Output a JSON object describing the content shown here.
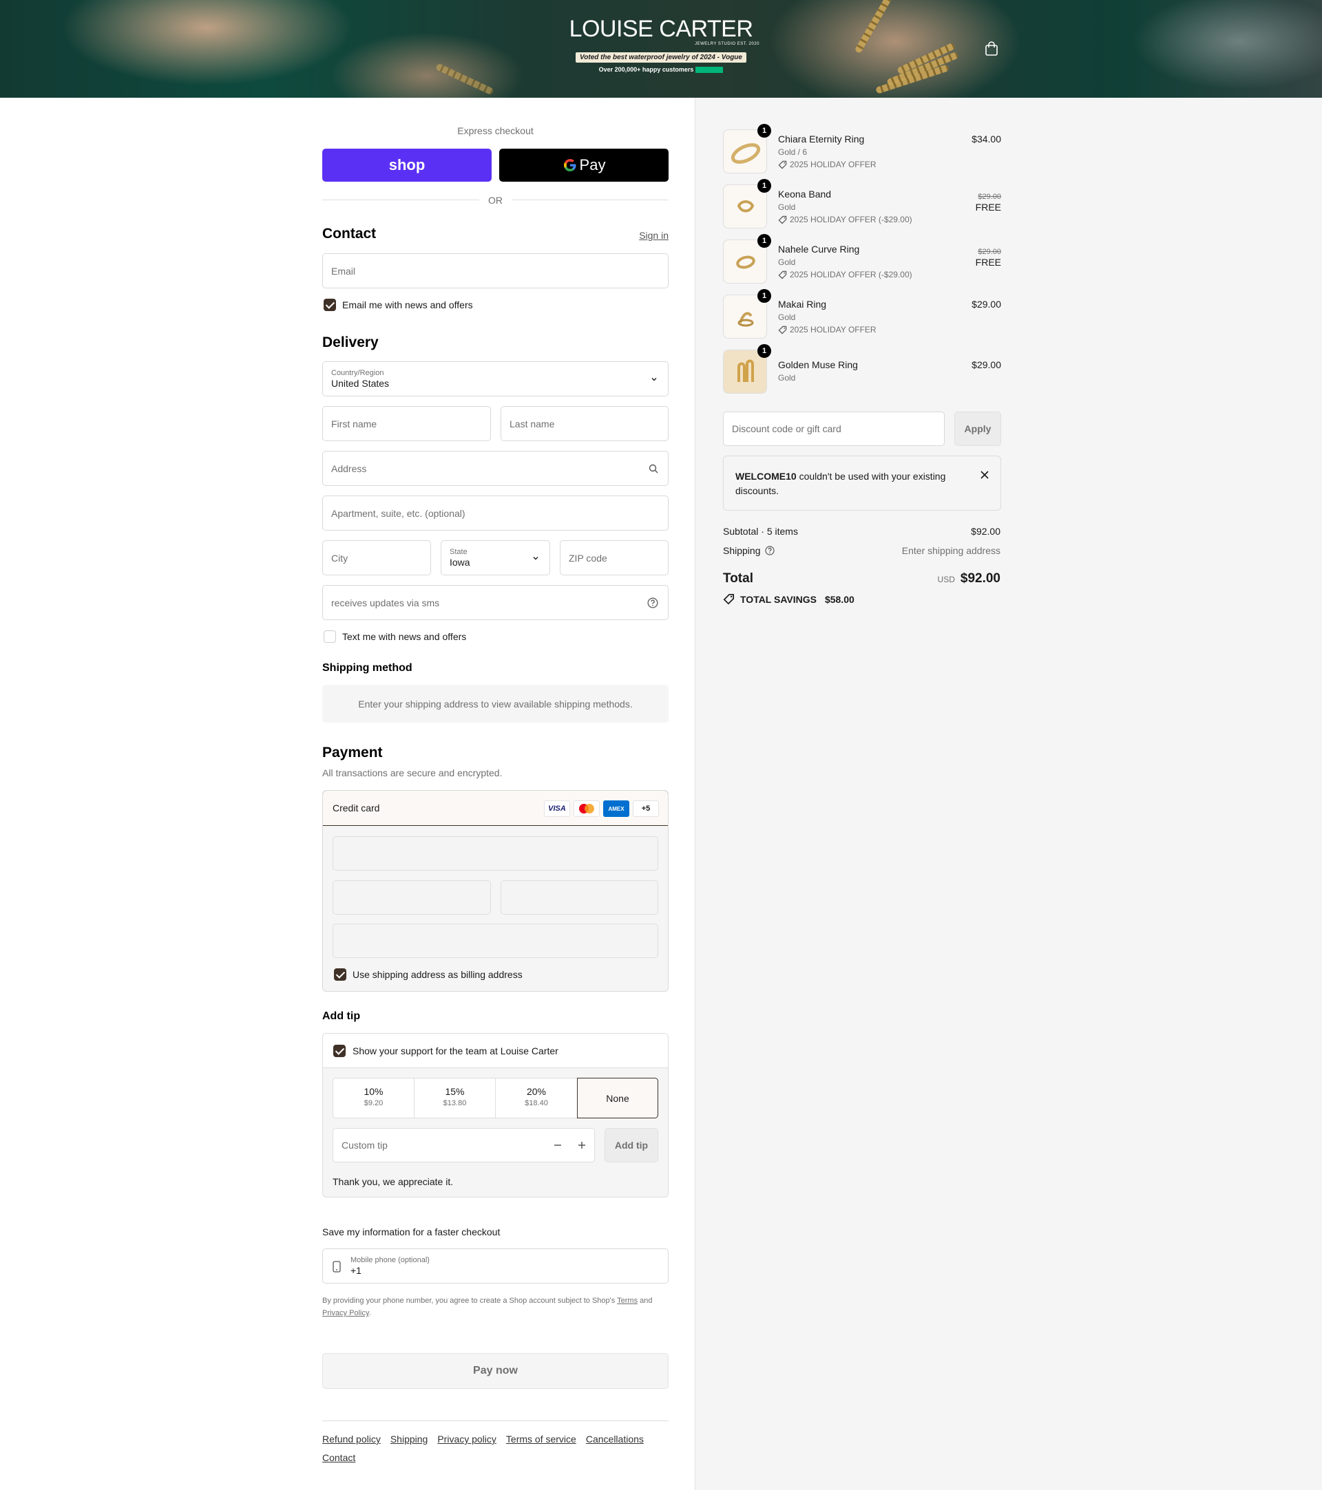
{
  "header": {
    "brand_name": "LOUISE CARTER",
    "brand_sub": "JEWELRY STUDIO EST. 2020",
    "badge": "Voted the best waterproof jewelry of 2024 - Vogue",
    "happy": "Over 200,000+ happy customers"
  },
  "express": {
    "title": "Express checkout",
    "shop_label": "shop",
    "gpay_label": "Pay",
    "or_label": "OR"
  },
  "contact": {
    "title": "Contact",
    "sign_in": "Sign in",
    "email_placeholder": "Email",
    "news_label": "Email me with news and offers"
  },
  "delivery": {
    "title": "Delivery",
    "country_label": "Country/Region",
    "country_value": "United States",
    "first_name": "First name",
    "last_name": "Last name",
    "address": "Address",
    "apartment": "Apartment, suite, etc. (optional)",
    "city": "City",
    "state_label": "State",
    "state_value": "Iowa",
    "zip": "ZIP code",
    "phone": "receives updates via sms",
    "sms_label": "Text me with news and offers"
  },
  "shipping_method": {
    "title": "Shipping method",
    "message": "Enter your shipping address to view available shipping methods."
  },
  "payment": {
    "title": "Payment",
    "subtitle": "All transactions are secure and encrypted.",
    "method": "Credit card",
    "cards": [
      "VISA",
      "MC",
      "AMEX",
      "+5"
    ],
    "billing_label": "Use shipping address as billing address"
  },
  "tip": {
    "title": "Add tip",
    "support_label": "Show your support for the team at Louise Carter",
    "options": [
      {
        "pct": "10%",
        "amount": "$9.20"
      },
      {
        "pct": "15%",
        "amount": "$13.80"
      },
      {
        "pct": "20%",
        "amount": "$18.40"
      },
      {
        "pct": "None",
        "amount": ""
      }
    ],
    "custom_placeholder": "Custom tip",
    "add_button": "Add tip",
    "thanks": "Thank you, we appreciate it."
  },
  "save_info": {
    "title": "Save my information for a faster checkout",
    "phone_label": "Mobile phone (optional)",
    "phone_value": "+1",
    "legal_prefix": "By providing your phone number, you agree to create a Shop account subject to Shop's",
    "terms": "Terms",
    "and": "and",
    "privacy": "Privacy Policy",
    "period": "."
  },
  "pay_button": "Pay now",
  "footer_links": [
    "Refund policy",
    "Shipping",
    "Privacy policy",
    "Terms of service",
    "Cancellations",
    "Contact"
  ],
  "order": {
    "items": [
      {
        "name": "Chiara Eternity Ring",
        "variant": "Gold / 6",
        "offer": "2025 HOLIDAY OFFER",
        "qty": "1",
        "price": "$34.00",
        "original": ""
      },
      {
        "name": "Keona Band",
        "variant": "Gold",
        "offer": "2025 HOLIDAY OFFER (-$29.00)",
        "qty": "1",
        "price": "FREE",
        "original": "$29.00"
      },
      {
        "name": "Nahele Curve Ring",
        "variant": "Gold",
        "offer": "2025 HOLIDAY OFFER (-$29.00)",
        "qty": "1",
        "price": "FREE",
        "original": "$29.00"
      },
      {
        "name": "Makai Ring",
        "variant": "Gold",
        "offer": "2025 HOLIDAY OFFER",
        "qty": "1",
        "price": "$29.00",
        "original": ""
      },
      {
        "name": "Golden Muse Ring",
        "variant": "Gold",
        "offer": "",
        "qty": "1",
        "price": "$29.00",
        "original": ""
      }
    ],
    "discount_placeholder": "Discount code or gift card",
    "apply": "Apply",
    "notice_code": "WELCOME10",
    "notice_text": " couldn't be used with your existing discounts.",
    "subtotal_label": "Subtotal · 5 items",
    "subtotal_value": "$92.00",
    "shipping_label": "Shipping",
    "shipping_value": "Enter shipping address",
    "total_label": "Total",
    "currency": "USD",
    "total_value": "$92.00",
    "savings_label": "TOTAL SAVINGS",
    "savings_value": "$58.00"
  }
}
